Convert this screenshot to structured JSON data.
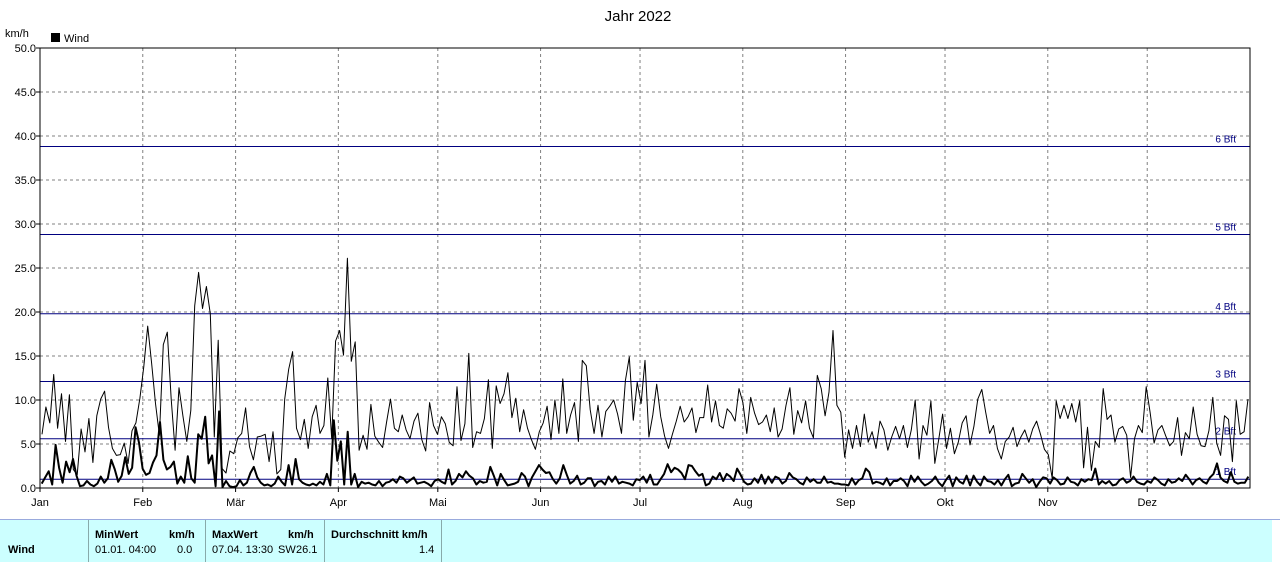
{
  "chart_data": {
    "type": "line",
    "title": "Jahr 2022",
    "ylabel": "km/h",
    "ylim": [
      0,
      50
    ],
    "y_ticks": [
      "0.0",
      "5.0",
      "10.0",
      "15.0",
      "20.0",
      "25.0",
      "30.0",
      "35.0",
      "40.0",
      "45.0",
      "50.0"
    ],
    "x_ticks": [
      "Jan",
      "Feb",
      "Mär",
      "Apr",
      "Mai",
      "Jun",
      "Jul",
      "Aug",
      "Sep",
      "Okt",
      "Nov",
      "Dez"
    ],
    "grid": true,
    "legend": {
      "placement": "top-left",
      "entries": [
        "Wind"
      ]
    },
    "colors": {
      "series": "#000000",
      "bft_lines": "#000080",
      "grid": "#808080"
    },
    "beaufort_lines": [
      {
        "label": "1 Bft",
        "value": 1.0
      },
      {
        "label": "2 Bft",
        "value": 5.6
      },
      {
        "label": "3 Bft",
        "value": 12.1
      },
      {
        "label": "4 Bft",
        "value": 19.8
      },
      {
        "label": "5 Bft",
        "value": 28.8
      },
      {
        "label": "6 Bft",
        "value": 38.8
      }
    ],
    "series": [
      {
        "name": "Wind",
        "role": "gust",
        "values": [
          6.1,
          9.2,
          7.4,
          12.9,
          6.8,
          10.7,
          5.3,
          10.6,
          2.1,
          1.5,
          6.7,
          4.1,
          7.9,
          2.9,
          8.2,
          10.1,
          11.0,
          6.9,
          4.5,
          3.7,
          3.8,
          5.1,
          2.8,
          6.5,
          7.4,
          10.2,
          13.8,
          18.4,
          14.2,
          9.6,
          6.0,
          16.3,
          17.7,
          10.1,
          4.3,
          11.4,
          8.2,
          5.3,
          8.8,
          20.7,
          24.5,
          20.4,
          22.9,
          19.8,
          5.8,
          16.8,
          2.2,
          1.7,
          4.2,
          3.9,
          5.7,
          6.2,
          9.1,
          4.7,
          3.2,
          5.8,
          5.9,
          6.1,
          3.0,
          6.4,
          1.6,
          2.1,
          10.1,
          13.5,
          15.5,
          6.8,
          5.5,
          7.8,
          4.5,
          8.1,
          9.4,
          6.2,
          7.1,
          12.5,
          5.6,
          16.7,
          17.9,
          15.1,
          26.1,
          14.4,
          16.6,
          4.3,
          6.0,
          4.4,
          9.5,
          5.9,
          5.2,
          4.6,
          7.5,
          10.1,
          6.8,
          6.4,
          8.3,
          6.6,
          5.6,
          7.6,
          8.5,
          5.5,
          4.2,
          9.7,
          7.1,
          6.1,
          8.1,
          7.3,
          5.2,
          4.8,
          11.5,
          5.4,
          7.3,
          15.3,
          4.6,
          6.4,
          6.2,
          7.9,
          12.3,
          4.5,
          11.6,
          9.6,
          10.7,
          13.1,
          8.0,
          10.2,
          6.4,
          8.9,
          6.8,
          5.5,
          4.4,
          6.4,
          7.4,
          9.3,
          5.5,
          10.0,
          6.2,
          12.4,
          6.2,
          8.3,
          9.7,
          5.3,
          14.5,
          13.9,
          8.9,
          6.2,
          9.4,
          5.8,
          8.7,
          9.3,
          10.0,
          8.4,
          6.2,
          12.2,
          14.9,
          7.7,
          12.0,
          9.6,
          14.5,
          5.8,
          8.3,
          11.8,
          8.1,
          5.9,
          4.5,
          6.1,
          7.6,
          9.3,
          7.5,
          8.1,
          9.1,
          6.3,
          8.0,
          8.0,
          11.7,
          7.5,
          9.9,
          7.1,
          6.8,
          9.0,
          8.5,
          7.6,
          11.3,
          9.7,
          6.2,
          10.3,
          8.5,
          7.2,
          7.5,
          8.3,
          6.4,
          9.1,
          5.8,
          6.7,
          9.4,
          11.4,
          6.1,
          8.8,
          7.4,
          9.9,
          6.8,
          5.7,
          12.8,
          11.3,
          8.2,
          10.9,
          17.9,
          9.4,
          8.6,
          3.5,
          6.6,
          4.5,
          7.1,
          4.7,
          8.4,
          5.2,
          6.4,
          4.5,
          7.6,
          6.6,
          4.3,
          5.8,
          7.0,
          5.6,
          7.1,
          4.6,
          6.6,
          10.0,
          3.3,
          7.1,
          6.0,
          9.9,
          2.8,
          5.5,
          8.4,
          4.5,
          6.8,
          3.9,
          5.2,
          7.4,
          8.2,
          4.9,
          7.0,
          10.1,
          11.2,
          8.6,
          6.2,
          7.1,
          4.5,
          3.3,
          5.3,
          5.8,
          6.9,
          4.7,
          5.8,
          6.6,
          5.2,
          6.7,
          7.6,
          6.1,
          4.4,
          3.8,
          1.1,
          9.9,
          7.9,
          9.4,
          7.9,
          9.6,
          7.5,
          9.9,
          2.3,
          6.9,
          2.0,
          5.3,
          4.6,
          11.3,
          7.8,
          8.3,
          5.2,
          6.7,
          7.0,
          6.0,
          1.2,
          5.6,
          7.1,
          6.3,
          11.5,
          8.6,
          5.1,
          6.6,
          7.1,
          5.9,
          4.8,
          5.3,
          8.0,
          3.7,
          6.3,
          5.6,
          9.2,
          6.1,
          4.8,
          4.7,
          6.5,
          10.3,
          5.1,
          3.7,
          8.2,
          7.8,
          3.0,
          9.9,
          6.1,
          6.4,
          10.1
        ]
      },
      {
        "name": "Wind",
        "role": "mean",
        "values": [
          0.5,
          1.2,
          1.9,
          0.4,
          4.9,
          2.3,
          0.6,
          3.0,
          1.8,
          3.3,
          1.4,
          0.2,
          0.3,
          0.8,
          0.4,
          0.2,
          0.5,
          1.3,
          0.6,
          1.1,
          3.2,
          2.1,
          0.7,
          1.4,
          3.5,
          1.6,
          2.3,
          6.9,
          5.1,
          2.2,
          1.5,
          1.7,
          2.9,
          3.7,
          7.5,
          3.2,
          2.1,
          2.4,
          3.0,
          0.5,
          1.3,
          0.6,
          3.6,
          1.1,
          0.6,
          6.1,
          5.6,
          8.1,
          2.8,
          3.7,
          0.2,
          8.7,
          0.1,
          0.8,
          0.2,
          0.1,
          0.2,
          0.9,
          0.3,
          0.6,
          1.7,
          2.4,
          1.2,
          0.6,
          0.3,
          0.4,
          0.2,
          0.5,
          1.3,
          0.7,
          0.3,
          2.6,
          0.4,
          3.3,
          1.0,
          0.6,
          0.4,
          0.3,
          0.5,
          0.3,
          0.7,
          0.4,
          1.6,
          0.3,
          7.7,
          3.1,
          5.3,
          0.4,
          6.4,
          0.4,
          1.6,
          0.1,
          0.7,
          0.5,
          0.6,
          0.4,
          0.3,
          0.8,
          0.2,
          0.6,
          0.7,
          1.0,
          0.6,
          1.3,
          1.1,
          0.6,
          0.9,
          1.2,
          0.5,
          0.6,
          0.7,
          0.5,
          0.2,
          0.8,
          1.0,
          0.7,
          0.5,
          2.1,
          0.4,
          0.8,
          1.6,
          1.2,
          1.9,
          1.4,
          1.1,
          0.4,
          0.8,
          0.6,
          0.7,
          2.4,
          1.4,
          0.3,
          1.6,
          0.9,
          0.3,
          0.4,
          0.5,
          0.7,
          1.7,
          1.3,
          0.2,
          1.2,
          1.9,
          2.6,
          2.1,
          1.7,
          1.8,
          1.0,
          0.5,
          1.1,
          2.6,
          1.5,
          0.5,
          0.8,
          1.4,
          0.4,
          0.6,
          1.1,
          1.1,
          0.2,
          0.7,
          0.8,
          0.4,
          1.3,
          0.7,
          1.3,
          0.5,
          0.7,
          0.6,
          0.5,
          0.3,
          1.0,
          0.9,
          1.3,
          0.6,
          1.5,
          0.4,
          0.4,
          1.0,
          1.6,
          2.7,
          1.8,
          2.3,
          2.1,
          1.7,
          1.0,
          2.6,
          2.5,
          1.9,
          1.4,
          1.6,
          0.3,
          0.5,
          1.3,
          1.0,
          1.7,
          0.8,
          1.6,
          1.3,
          0.8,
          2.2,
          1.5,
          0.7,
          0.4,
          0.5,
          1.1,
          0.6,
          1.5,
          0.5,
          1.3,
          0.6,
          1.3,
          1.1,
          0.5,
          0.8,
          1.7,
          1.2,
          1.0,
          0.6,
          0.4,
          1.2,
          0.7,
          1.0,
          0.6,
          0.6,
          1.3,
          0.6,
          0.7,
          0.5,
          0.5,
          0.4,
          0.4,
          0.3,
          1.1,
          0.4,
          0.9,
          1.1,
          2.2,
          1.8,
          0.5,
          0.7,
          0.6,
          0.4,
          1.1,
          0.3,
          0.8,
          0.8,
          1.1,
          0.8,
          0.2,
          1.4,
          0.7,
          1.3,
          0.7,
          0.3,
          0.5,
          0.8,
          1.3,
          0.6,
          0.2,
          0.9,
          1.4,
          0.2,
          1.2,
          0.7,
          0.5,
          1.4,
          0.3,
          1.4,
          0.7,
          0.3,
          1.3,
          0.8,
          0.7,
          0.4,
          0.9,
          0.3,
          1.0,
          1.5,
          0.2,
          0.5,
          0.6,
          1.6,
          1.1,
          0.6,
          1.0,
          0.1,
          0.7,
          1.2,
          1.1,
          0.5,
          1.2,
          0.9,
          0.4,
          0.5,
          1.2,
          0.7,
          0.6,
          0.3,
          1.0,
          0.7,
          1.0,
          0.9,
          2.2,
          0.4,
          0.8,
          0.5,
          0.8,
          0.3,
          0.4,
          0.9,
          1.1,
          0.6,
          0.8,
          1.3,
          0.7,
          0.5,
          0.4,
          0.8,
          0.6,
          1.2,
          0.9,
          0.5,
          0.3,
          1.0,
          0.6,
          0.7,
          1.1,
          0.8,
          1.5,
          1.0,
          0.4,
          0.9,
          1.1,
          0.7,
          0.5,
          1.2,
          1.6,
          2.8,
          1.2,
          0.8,
          0.6,
          1.8,
          0.7,
          0.5,
          0.6,
          0.6,
          1.3
        ]
      }
    ]
  },
  "summary": {
    "row_label": "Wind",
    "min_header": "MinWert",
    "min_unit": "km/h",
    "min_time": "01.01.  04:00",
    "min_value": "0.0",
    "max_header": "MaxWert",
    "max_unit": "km/h",
    "max_time": "07.04.  13:30",
    "max_dir": "SW",
    "max_value": "26.1",
    "avg_header": "Durchschnitt km/h",
    "avg_value": "1.4"
  }
}
